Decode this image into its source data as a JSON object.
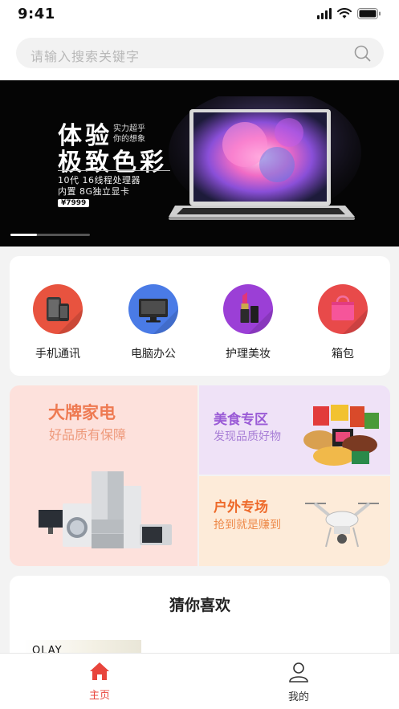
{
  "status_bar": {
    "time": "9:41"
  },
  "search": {
    "placeholder": "请输入搜索关键字"
  },
  "banner": {
    "title_line1": "体验",
    "title_line2": "极致色彩",
    "side_line1": "实力超乎",
    "side_line2": "你的想象",
    "spec_line1": "10代 16线程处理器",
    "spec_line2": "内置 8G独立显卡",
    "price": "¥7999",
    "progress": 0.33
  },
  "categories": [
    {
      "label": "手机通讯",
      "icon": "phone-icon",
      "color": "#e8533f"
    },
    {
      "label": "电脑办公",
      "icon": "monitor-icon",
      "color": "#4a7be6"
    },
    {
      "label": "护理美妆",
      "icon": "lipstick-icon",
      "color": "#9b3fd6"
    },
    {
      "label": "箱包",
      "icon": "bag-icon",
      "color": "#e84a4a"
    }
  ],
  "promos": {
    "appliances": {
      "title": "大牌家电",
      "subtitle": "好品质有保障"
    },
    "food": {
      "title": "美食专区",
      "subtitle": "发现品质好物"
    },
    "outdoor": {
      "title": "户外专场",
      "subtitle": "抢到就是赚到"
    }
  },
  "recommend": {
    "title": "猜你喜欢",
    "first_item_brand": "OLAY"
  },
  "tabbar": {
    "items": [
      {
        "label": "主页",
        "icon": "home-icon",
        "active": true
      },
      {
        "label": "我的",
        "icon": "user-icon",
        "active": false
      }
    ],
    "active_color": "#e8453c"
  }
}
